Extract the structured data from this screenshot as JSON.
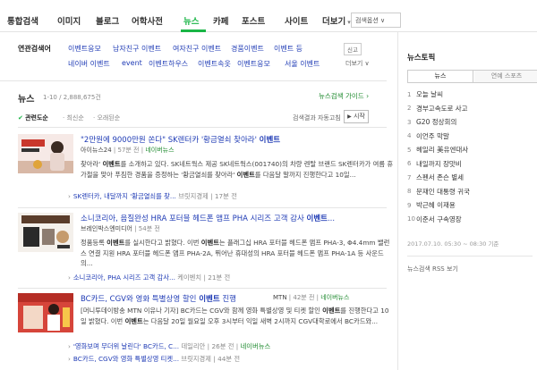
{
  "tabs": [
    {
      "label": "통합검색"
    },
    {
      "label": "이미지"
    },
    {
      "label": "블로그"
    },
    {
      "label": "어학사전"
    },
    {
      "label": "뉴스"
    },
    {
      "label": "카페"
    },
    {
      "label": "포스트"
    },
    {
      "label": "사이트"
    },
    {
      "label": "더보기"
    }
  ],
  "search_option": "검색옵션 ∨",
  "related": {
    "title": "연관검색어",
    "items": [
      "이벤트응모",
      "남자친구 이벤트",
      "여자친구 이벤트",
      "경품이벤트",
      "이벤트 등",
      "네이버 이벤트",
      "event",
      "이벤트하우스",
      "이벤트속옷",
      "이벤트응모",
      "서울 이벤트"
    ],
    "report": "신고",
    "more": "더보기 ∨"
  },
  "news": {
    "title": "뉴스",
    "count": "1-10 / 2,888,675건",
    "guide": "뉴스검색 가이드",
    "sorts": [
      "관련도순",
      "최신순",
      "오래된순"
    ],
    "auto_refresh": "검색결과 자동고침",
    "start": "시작"
  },
  "items": [
    {
      "title_a": "\"2만원에 9000만원 쏜다\" SK렌터카 '황금열쇠 찾아라' ",
      "title_b": "이벤트",
      "source": "아이뉴스24",
      "time": "57분 전",
      "via": "네이버뉴스",
      "body_a": "찾아라' ",
      "body_b": "이벤트",
      "body_c": "를 소개하고 있다. SK네트웍스 제공 SK네트웍스(001740)의 차량 렌탈 브랜드 SK렌터카가 여름 휴가철을 맞아 푸짐한 경품을 증정하는 '황금열쇠를 찾아라' ",
      "body_d": "이벤트",
      "body_e": "를 다음달 말까지 진행한다고 10일...",
      "sub": [
        {
          "label": "SK렌터카, 내달까지 '황금열쇠를 찾...",
          "source": "브릿지경제",
          "time": "17분 전"
        }
      ]
    },
    {
      "title_a": "소니코리아, 음질완성 HRA 포터블 헤드폰 앰프 PHA 시리즈 고객 감사 ",
      "title_b": "이벤트",
      "title_c": "...",
      "source": "브레인박스엔미디어",
      "time": "54분 전",
      "body_a": "정품등록 ",
      "body_b": "이벤트",
      "body_c": "를 실시한다고 밝혔다. 이번 ",
      "body_d": "이벤트",
      "body_e": "는 플래그십 HRA 포터블 헤드폰 앰프 PHA-3, Φ4.4mm 밸런스 연결 지원 HRA 포터블 헤드폰 앰프 PHA-2A, 뛰어난 휴대성의 HRA 포터블 헤드폰 앰프 PHA-1A 등 사운드의...",
      "sub": [
        {
          "label": "소니코리아, PHA 시리즈 고객 감사...",
          "source": "케이벤치",
          "time": "21분 전"
        }
      ]
    },
    {
      "title_a": "BC카드, CGV와 영화 특별상영 할인 ",
      "title_b": "이벤트",
      "title_c": " 진행",
      "source": "MTN",
      "time": "42분 전",
      "via": "네이버뉴스",
      "body_a": "[머니투데이방송 MTN 이유나 기자] BC카드는 CGV와 함께 영화 특별상영 및 티켓 할인 ",
      "body_b": "이벤트",
      "body_c": "를 진행한다고 10일 밝혔다. 이번 ",
      "body_d": "이벤트",
      "body_e": "는 다음달 20일 월요일 오후 3시부터 익일 새벽 2시까지 CGV대학로에서 BC카드와...",
      "sub": [
        {
          "label": "'영화보며 무더위 날린다' BC카드, C...",
          "source": "데일리안",
          "time": "26분 전",
          "via": "네이버뉴스"
        },
        {
          "label": "BC카드, CGV와 영화 특별상영 티켓...",
          "source": "브릿지경제",
          "time": "44분 전"
        }
      ]
    }
  ],
  "sidebar": {
    "title": "뉴스토픽",
    "tabs": [
      "뉴스",
      "연예 스포츠"
    ],
    "topics": [
      {
        "num": "1",
        "text": "오늘 날씨"
      },
      {
        "num": "2",
        "text": "경부고속도로 사고"
      },
      {
        "num": "3",
        "text": "G20 정상회의"
      },
      {
        "num": "4",
        "text": "이언주 막말"
      },
      {
        "num": "5",
        "text": "헤일리 美유엔대사"
      },
      {
        "num": "6",
        "text": "내일까지 장맛비"
      },
      {
        "num": "7",
        "text": "스펜서 존슨 별세"
      },
      {
        "num": "8",
        "text": "문재인 대통령 귀국"
      },
      {
        "num": "9",
        "text": "박근혜 이재용"
      },
      {
        "num": "10",
        "text": "이준서 구속영장"
      }
    ],
    "time": "2017.07.10. 05:30 ~ 08:30 기준",
    "rss": "뉴스검색 RSS 보기"
  }
}
